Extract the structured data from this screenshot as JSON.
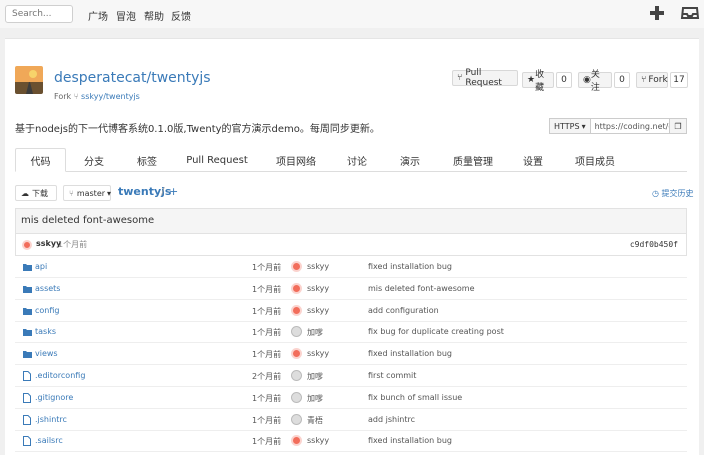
{
  "topbar": {
    "search_placeholder": "Search...",
    "nav": [
      "广场",
      "冒泡",
      "帮助",
      "反馈"
    ]
  },
  "repo": {
    "full_name": "desperatecat/twentyjs",
    "fork_label": "Fork",
    "fork_source": "sskyy/twentyjs",
    "description": "基于nodejs的下一代博客系统0.1.0版,Twenty的官方演示demo。每周同步更新。"
  },
  "actions": {
    "pull_request": "Pull Request",
    "star_label": "收藏",
    "star_count": "0",
    "watch_label": "关注",
    "watch_count": "0",
    "fork_label": "Fork",
    "fork_count": "17"
  },
  "clone": {
    "protocol": "HTTPS",
    "url": "https://coding.net/desp"
  },
  "tabs": [
    "代码",
    "分支",
    "标签",
    "Pull Request",
    "项目网络",
    "讨论",
    "演示",
    "质量管理",
    "设置",
    "项目成员"
  ],
  "toolbar": {
    "download": "下载",
    "branch": "master",
    "repo_crumb": "twentyjs",
    "separator": "/",
    "plus": "+",
    "history": "提交历史"
  },
  "last_commit": {
    "message": "mis deleted font-awesome",
    "author": "sskyy",
    "age": "1个月前",
    "hash": "c9df0b450f"
  },
  "files": [
    {
      "name": "api",
      "type": "folder",
      "age": "1个月前",
      "user": "sskyy",
      "message": "fixed installation bug"
    },
    {
      "name": "assets",
      "type": "folder",
      "age": "1个月前",
      "user": "sskyy",
      "message": "mis deleted font-awesome"
    },
    {
      "name": "config",
      "type": "folder",
      "age": "1个月前",
      "user": "sskyy",
      "message": "add configuration"
    },
    {
      "name": "tasks",
      "type": "folder",
      "age": "1个月前",
      "user": "加嗲",
      "message": "fix bug for duplicate creating post"
    },
    {
      "name": "views",
      "type": "folder",
      "age": "1个月前",
      "user": "sskyy",
      "message": "fixed installation bug"
    },
    {
      "name": ".editorconfig",
      "type": "file",
      "age": "2个月前",
      "user": "加嗲",
      "message": "first commit"
    },
    {
      "name": ".gitignore",
      "type": "file",
      "age": "1个月前",
      "user": "加嗲",
      "message": "fix bunch of small issue"
    },
    {
      "name": ".jshintrc",
      "type": "file",
      "age": "1个月前",
      "user": "青梧",
      "message": "add jshintrc"
    },
    {
      "name": ".sailsrc",
      "type": "file",
      "age": "1个月前",
      "user": "sskyy",
      "message": "fixed installation bug"
    }
  ]
}
